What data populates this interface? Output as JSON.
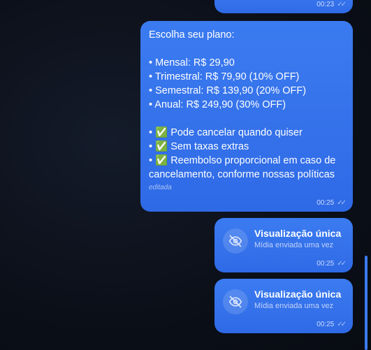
{
  "messages": {
    "top": {
      "time": "00:23"
    },
    "plan": {
      "text": "Escolha seu plano:\n\n• Mensal: R$ 29,90\n• Trimestral: R$ 79,90 (10% OFF)\n• Semestral: R$ 139,90 (20% OFF)\n• Anual: R$ 249,90 (30% OFF)\n\n• ✅ Pode cancelar quando quiser\n• ✅ Sem taxas extras\n• ✅ Reembolso proporcional em caso de cancelamento, conforme nossas políticas",
      "edited_label": "editada",
      "time": "00:25"
    },
    "view_once_1": {
      "title": "Visualização única",
      "subtitle": "Mídia enviada uma vez",
      "time": "00:25",
      "icon": "eye-off-icon"
    },
    "view_once_2": {
      "title": "Visualização única",
      "subtitle": "Mídia enviada uma vez",
      "time": "00:25",
      "icon": "eye-off-icon"
    }
  },
  "colors": {
    "bubble": "#2f6ae6",
    "background": "#0b0f18",
    "scrollbar": "#3b7bf0"
  }
}
